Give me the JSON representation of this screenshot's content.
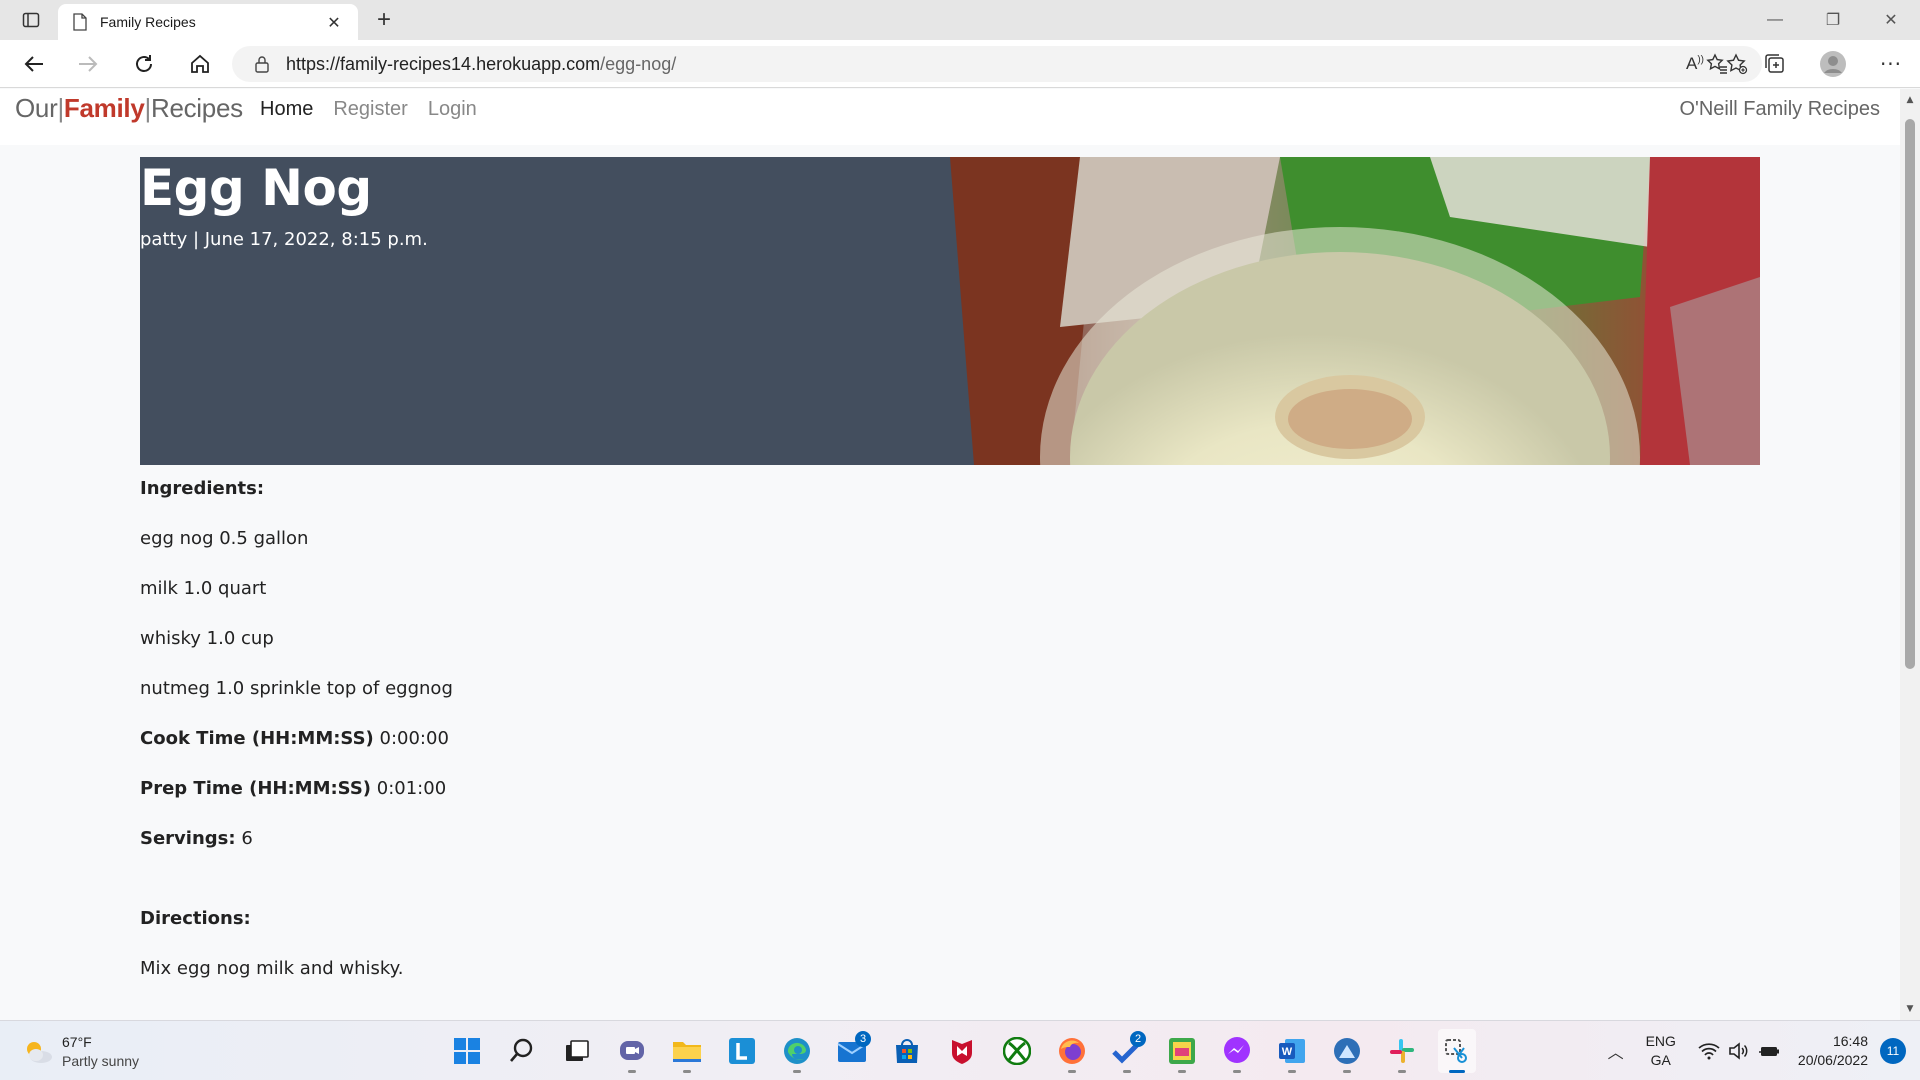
{
  "browser": {
    "tab_title": "Family Recipes",
    "url_domain": "https://family-recipes14.herokuapp.com",
    "url_path": "/egg-nog/"
  },
  "site": {
    "brand_our": "Our",
    "brand_family": "Family",
    "brand_recipes": "Recipes",
    "nav": {
      "home": "Home",
      "register": "Register",
      "login": "Login"
    },
    "nav_right": "O'Neill Family Recipes"
  },
  "recipe": {
    "title": "Egg Nog",
    "meta": "patty | June 17, 2022, 8:15 p.m.",
    "ingredients_label": "Ingredients:",
    "ingredients": [
      "egg nog 0.5 gallon",
      "milk 1.0 quart",
      "whisky 1.0 cup",
      "nutmeg 1.0 sprinkle top of eggnog"
    ],
    "cook_time_label": "Cook Time (HH:MM:SS)",
    "cook_time": "0:00:00",
    "prep_time_label": "Prep Time (HH:MM:SS)",
    "prep_time": "0:01:00",
    "servings_label": "Servings:",
    "servings": "6",
    "directions_label": "Directions:",
    "directions": "Mix egg nog milk and whisky."
  },
  "taskbar": {
    "weather_temp": "67°F",
    "weather_desc": "Partly sunny",
    "mail_badge": "3",
    "todo_badge": "2",
    "lang_1": "ENG",
    "lang_2": "GA",
    "time": "16:48",
    "date": "20/06/2022",
    "notifications": "11"
  },
  "colors": {
    "hero_bg": "#434e5e",
    "brand_accent": "#c0392b",
    "accent_blue": "#0067c0"
  }
}
